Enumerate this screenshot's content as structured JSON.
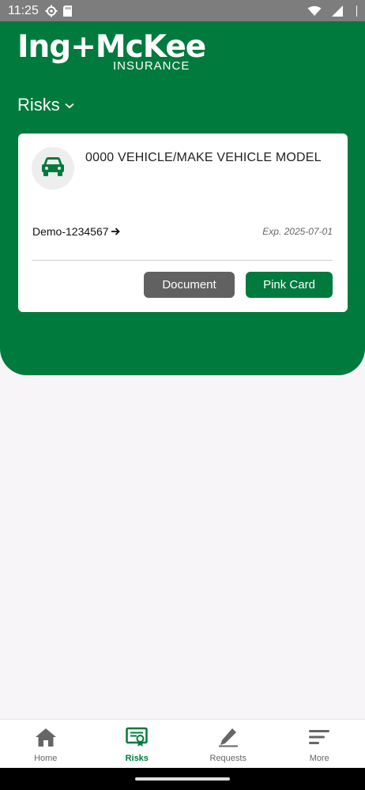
{
  "status_bar": {
    "time": "11:25",
    "icons": [
      "settings-gear-icon",
      "sd-card-icon",
      "wifi-icon",
      "signal-icon"
    ]
  },
  "header": {
    "logo_brand": "Ing+McKee",
    "logo_sub": "INSURANCE",
    "section_title": "Risks",
    "background_color": "#007a3d"
  },
  "card": {
    "vehicle_title": "0000 VEHICLE/MAKE VEHICLE MODEL",
    "policy_number": "Demo-1234567",
    "expiry": "Exp. 2025-07-01",
    "document_button": "Document",
    "pink_card_button": "Pink Card"
  },
  "bottom_nav": {
    "items": [
      {
        "label": "Home",
        "icon": "home-icon"
      },
      {
        "label": "Risks",
        "icon": "certificate-icon",
        "active": true
      },
      {
        "label": "Requests",
        "icon": "pencil-icon"
      },
      {
        "label": "More",
        "icon": "menu-icon"
      }
    ]
  },
  "colors": {
    "accent": "#007a3d",
    "secondary_button": "#616161"
  }
}
